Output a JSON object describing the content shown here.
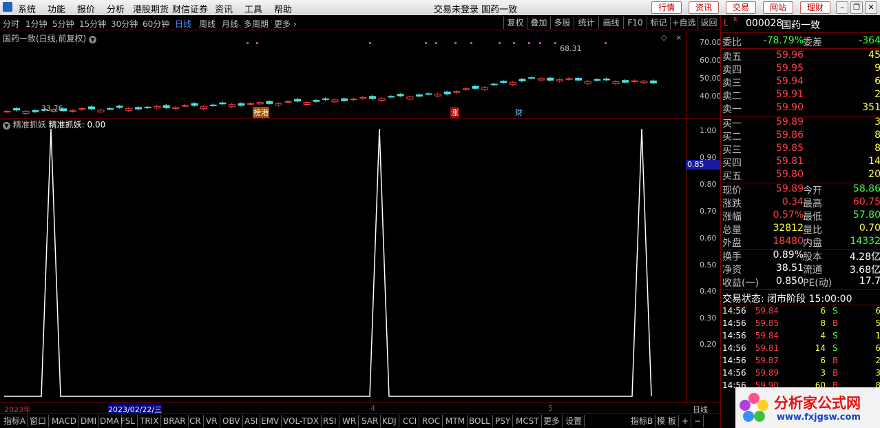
{
  "titlebar": {
    "menu": [
      "系统",
      "功能",
      "报价",
      "分析",
      "港股期货",
      "财信证券",
      "资讯",
      "工具",
      "帮助"
    ],
    "center_text": "交易未登录  国药一致",
    "buttons": [
      "行情",
      "资讯",
      "交易",
      "网站",
      "理财"
    ]
  },
  "periodbar": {
    "items": [
      "分时",
      "1分钟",
      "5分钟",
      "15分钟",
      "30分钟",
      "60分钟",
      "日线",
      "周线",
      "月线",
      "多周期",
      "更多 ›"
    ],
    "active": "日线",
    "tools": [
      "复权",
      "叠加",
      "多股",
      "统计",
      "画线",
      "F10",
      "标记",
      "+自选",
      "返回"
    ]
  },
  "mainchart": {
    "title": "国药一致(日线,前复权)",
    "high_label": "68.31",
    "low_label": "33.76",
    "yticks": [
      "70.00",
      "60.00",
      "50.00",
      "40.00"
    ],
    "markers": [
      "榜港",
      "涨",
      "财"
    ]
  },
  "indicator": {
    "name": "精准抓妖",
    "label": "精准抓妖:",
    "value": "0.00",
    "yticks": [
      "1.00",
      "0.90",
      "0.80",
      "0.70",
      "0.60",
      "0.50",
      "0.40",
      "0.30",
      "0.20"
    ],
    "cursor_value": "0.85"
  },
  "chart_data": {
    "type": "line",
    "title": "精准抓妖",
    "series": [
      {
        "name": "精准抓妖",
        "values": [
          0,
          1,
          0,
          0,
          1,
          0,
          0,
          1,
          0
        ]
      }
    ],
    "ylim": [
      0,
      1
    ]
  },
  "daterow": {
    "labels": [
      "2023年",
      "2023/02/22/三",
      "4",
      "5",
      "日线"
    ]
  },
  "indicator_bar": [
    "指标A",
    "窗口",
    "MACD",
    "DMI",
    "DMA",
    "FSL",
    "TRIX",
    "BRAR",
    "CR",
    "VR",
    "OBV",
    "ASI",
    "EMV",
    "VOL-TDX",
    "RSI",
    "WR",
    "SAR",
    "KDJ",
    "CCI",
    "ROC",
    "MTM",
    "BOLL",
    "PSY",
    "MCST",
    "更多",
    "设置",
    "指标B",
    "模 板",
    "+",
    "−"
  ],
  "quote": {
    "code": "000028",
    "name": "国药一致",
    "weibi_label": "委比",
    "weibi": "-78.79%",
    "weicha_label": "委差",
    "weicha": "-364",
    "asks": [
      {
        "label": "卖五",
        "price": "59.96",
        "vol": "45"
      },
      {
        "label": "卖四",
        "price": "59.95",
        "vol": "9"
      },
      {
        "label": "卖三",
        "price": "59.94",
        "vol": "6"
      },
      {
        "label": "卖二",
        "price": "59.91",
        "vol": "2"
      },
      {
        "label": "卖一",
        "price": "59.90",
        "vol": "351"
      }
    ],
    "bids": [
      {
        "label": "买一",
        "price": "59.89",
        "vol": "3"
      },
      {
        "label": "买二",
        "price": "59.86",
        "vol": "8"
      },
      {
        "label": "买三",
        "price": "59.85",
        "vol": "8"
      },
      {
        "label": "买四",
        "price": "59.81",
        "vol": "14"
      },
      {
        "label": "买五",
        "price": "59.80",
        "vol": "20"
      }
    ],
    "stats": [
      {
        "l1": "现价",
        "v1": "59.89",
        "c1": "red",
        "l2": "今开",
        "v2": "58.86",
        "c2": "green"
      },
      {
        "l1": "涨跌",
        "v1": "0.34",
        "c1": "red",
        "l2": "最高",
        "v2": "60.75",
        "c2": "red"
      },
      {
        "l1": "涨幅",
        "v1": "0.57%",
        "c1": "red",
        "l2": "最低",
        "v2": "57.80",
        "c2": "green"
      },
      {
        "l1": "总量",
        "v1": "32812",
        "c1": "yellow",
        "l2": "量比",
        "v2": "0.70",
        "c2": "yellow"
      },
      {
        "l1": "外盘",
        "v1": "18480",
        "c1": "red",
        "l2": "内盘",
        "v2": "14332",
        "c2": "green"
      }
    ],
    "stats2": [
      {
        "l1": "换手",
        "v1": "0.89%",
        "l2": "股本",
        "v2": "4.28亿"
      },
      {
        "l1": "净资",
        "v1": "38.51",
        "l2": "流通",
        "v2": "3.68亿"
      },
      {
        "l1": "收益(一)",
        "v1": "0.850",
        "l2": "PE(动)",
        "v2": "17.7"
      }
    ],
    "status": "交易状态: 闭市阶段 15:00:00",
    "ticks": [
      {
        "time": "14:56",
        "price": "59.84",
        "vol": "6",
        "bs": "S",
        "n": "6"
      },
      {
        "time": "14:56",
        "price": "59.85",
        "vol": "8",
        "bs": "B",
        "n": "5"
      },
      {
        "time": "14:56",
        "price": "59.84",
        "vol": "4",
        "bs": "S",
        "n": "1"
      },
      {
        "time": "14:56",
        "price": "59.81",
        "vol": "14",
        "bs": "S",
        "n": "6"
      },
      {
        "time": "14:56",
        "price": "59.87",
        "vol": "6",
        "bs": "B",
        "n": "2"
      },
      {
        "time": "14:56",
        "price": "59.89",
        "vol": "3",
        "bs": "B",
        "n": "3"
      },
      {
        "time": "14:56",
        "price": "59.90",
        "vol": "60",
        "bs": "B",
        "n": "8"
      }
    ]
  },
  "watermark": {
    "title": "分析家公式网",
    "url": "www.fxjgsw.com"
  }
}
